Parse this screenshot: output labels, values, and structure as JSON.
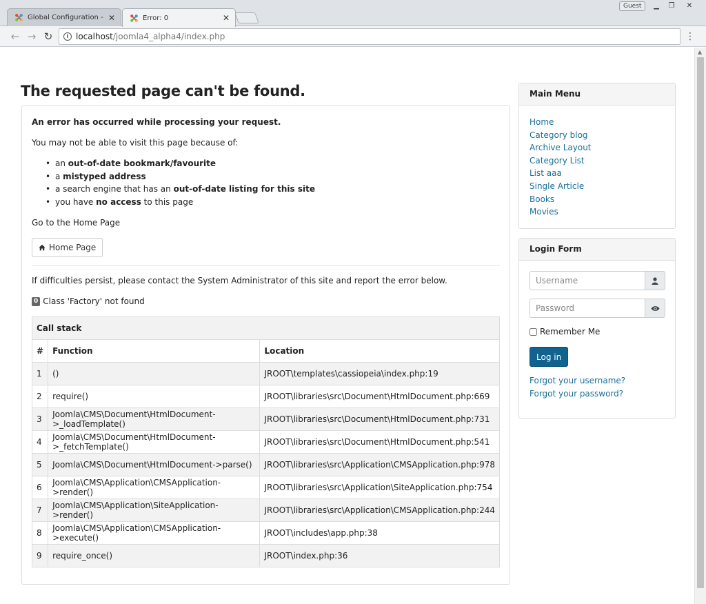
{
  "browser": {
    "tabs": [
      {
        "title": "Global Configuration - Joom",
        "active": false
      },
      {
        "title": "Error: 0",
        "active": true
      }
    ],
    "guest_label": "Guest",
    "url_host": "localhost",
    "url_path": "/joomla4_alpha4/index.php"
  },
  "page": {
    "title": "The requested page can't be found."
  },
  "error": {
    "heading": "An error has occurred while processing your request.",
    "intro": "You may not be able to visit this page because of:",
    "reasons": [
      {
        "pre": "an ",
        "bold": "out-of-date bookmark/favourite",
        "post": ""
      },
      {
        "pre": "a ",
        "bold": "mistyped address",
        "post": ""
      },
      {
        "pre": "a search engine that has an ",
        "bold": "out-of-date listing for this site",
        "post": ""
      },
      {
        "pre": "you have ",
        "bold": "no access",
        "post": " to this page"
      }
    ],
    "goto_text": "Go to the Home Page",
    "home_button": "Home Page",
    "contact_text": "If difficulties persist, please contact the System Administrator of this site and report the error below.",
    "code": "0",
    "message": "Class 'Factory' not found"
  },
  "callstack": {
    "caption": "Call stack",
    "headers": {
      "num": "#",
      "function": "Function",
      "location": "Location"
    },
    "rows": [
      {
        "num": "1",
        "function": "()",
        "location": "JROOT\\templates\\cassiopeia\\index.php:19"
      },
      {
        "num": "2",
        "function": "require()",
        "location": "JROOT\\libraries\\src\\Document\\HtmlDocument.php:669"
      },
      {
        "num": "3",
        "function": "Joomla\\CMS\\Document\\HtmlDocument->_loadTemplate()",
        "location": "JROOT\\libraries\\src\\Document\\HtmlDocument.php:731"
      },
      {
        "num": "4",
        "function": "Joomla\\CMS\\Document\\HtmlDocument->_fetchTemplate()",
        "location": "JROOT\\libraries\\src\\Document\\HtmlDocument.php:541"
      },
      {
        "num": "5",
        "function": "Joomla\\CMS\\Document\\HtmlDocument->parse()",
        "location": "JROOT\\libraries\\src\\Application\\CMSApplication.php:978"
      },
      {
        "num": "6",
        "function": "Joomla\\CMS\\Application\\CMSApplication->render()",
        "location": "JROOT\\libraries\\src\\Application\\SiteApplication.php:754"
      },
      {
        "num": "7",
        "function": "Joomla\\CMS\\Application\\SiteApplication->render()",
        "location": "JROOT\\libraries\\src\\Application\\CMSApplication.php:244"
      },
      {
        "num": "8",
        "function": "Joomla\\CMS\\Application\\CMSApplication->execute()",
        "location": "JROOT\\includes\\app.php:38"
      },
      {
        "num": "9",
        "function": "require_once()",
        "location": "JROOT\\index.php:36"
      }
    ]
  },
  "main_menu": {
    "title": "Main Menu",
    "items": [
      "Home",
      "Category blog",
      "Archive Layout",
      "Category List",
      "List aaa",
      "Single Article",
      "Books",
      "Movies"
    ]
  },
  "login": {
    "title": "Login Form",
    "username_placeholder": "Username",
    "password_placeholder": "Password",
    "remember_label": "Remember Me",
    "button": "Log in",
    "links": [
      "Forgot your username?",
      "Forgot your password?"
    ]
  }
}
